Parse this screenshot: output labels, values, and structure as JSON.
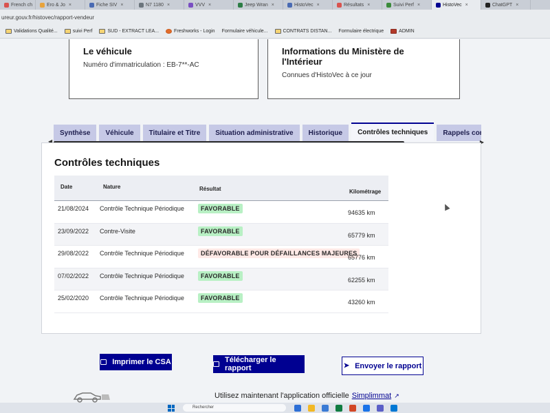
{
  "browser": {
    "tabs": [
      {
        "label": "French ch",
        "color": "#d9534f"
      },
      {
        "label": "Ero & Jo",
        "color": "#e8a33c"
      },
      {
        "label": "Fiche SIV",
        "color": "#4a6bb3"
      },
      {
        "label": "N7 1180",
        "color": "#6c757d"
      },
      {
        "label": "VVV",
        "color": "#7a4fc2"
      },
      {
        "label": "Jeep Wran",
        "color": "#2d7d46"
      },
      {
        "label": "HistoVec",
        "color": "#4a6bb3"
      },
      {
        "label": "Résultats",
        "color": "#d9534f"
      },
      {
        "label": "Suivi Perf",
        "color": "#3b8b3b"
      },
      {
        "label": "HistoVec",
        "color": "#000091",
        "active": true
      },
      {
        "label": "ChatGPT",
        "color": "#222"
      }
    ],
    "url": "ureur.gouv.fr/histovec/rapport-vendeur",
    "bookmarks": [
      {
        "label": "Validations Qualité...",
        "icon": "folder-icon"
      },
      {
        "label": "suivi Perf",
        "icon": "folder-icon"
      },
      {
        "label": "SUD - EXTRACT LEA...",
        "icon": "folder-icon"
      },
      {
        "label": "Freshworks - Login",
        "icon": "app-icon"
      },
      {
        "label": "Formulaire véhicule...",
        "icon": "page-icon"
      },
      {
        "label": "CONTRATS DISTAN...",
        "icon": "folder-icon"
      },
      {
        "label": "Formulaire électrique",
        "icon": "page-icon"
      },
      {
        "label": "ADMIN",
        "icon": "red-icon"
      }
    ]
  },
  "vehicle_card": {
    "title": "Le véhicule",
    "registration": "Numéro d'immatriculation : EB-7**-AC"
  },
  "ministry_card": {
    "title": "Informations du Ministère de l'Intérieur",
    "subtitle": "Connues d'HistoVec à ce jour"
  },
  "tabs": [
    {
      "label": "Synthèse"
    },
    {
      "label": "Véhicule"
    },
    {
      "label": "Titulaire et Titre"
    },
    {
      "label": "Situation administrative"
    },
    {
      "label": "Historique"
    },
    {
      "label": "Contrôles techniques",
      "active": true
    },
    {
      "label": "Rappels constru"
    }
  ],
  "section": {
    "title": "Contrôles techniques",
    "columns": {
      "date": "Date",
      "nature": "Nature",
      "result": "Résultat",
      "mileage": "Kilométrage"
    },
    "rows": [
      {
        "date": "21/08/2024",
        "nature": "Contrôle Technique Périodique",
        "result": "FAVORABLE",
        "status": "ok",
        "km": "94635 km"
      },
      {
        "date": "23/09/2022",
        "nature": "Contre-Visite",
        "result": "FAVORABLE",
        "status": "ok",
        "km": "65779 km"
      },
      {
        "date": "29/08/2022",
        "nature": "Contrôle Technique Périodique",
        "result": "DÉFAVORABLE POUR DÉFAILLANCES MAJEURES",
        "status": "ko",
        "km": "65776 km"
      },
      {
        "date": "07/02/2022",
        "nature": "Contrôle Technique Périodique",
        "result": "FAVORABLE",
        "status": "ok",
        "km": "62255 km"
      },
      {
        "date": "25/02/2020",
        "nature": "Contrôle Technique Périodique",
        "result": "FAVORABLE",
        "status": "ok",
        "km": "43260 km"
      }
    ]
  },
  "actions": {
    "print_csa": "Imprimer le CSA",
    "download_report": "Télécharger le rapport",
    "send_report": "Envoyer le rapport"
  },
  "footer": {
    "text": "Utilisez maintenant l'application officielle",
    "link": "Simplimmat"
  },
  "taskbar": {
    "search_placeholder": "Rechercher"
  },
  "colors": {
    "primary": "#000091",
    "tab_bg": "#c6c9e6",
    "success_bg": "#b8f0c4",
    "success_text": "#18753c",
    "error_bg": "#ffe9e6",
    "error_text": "#ce0500"
  }
}
